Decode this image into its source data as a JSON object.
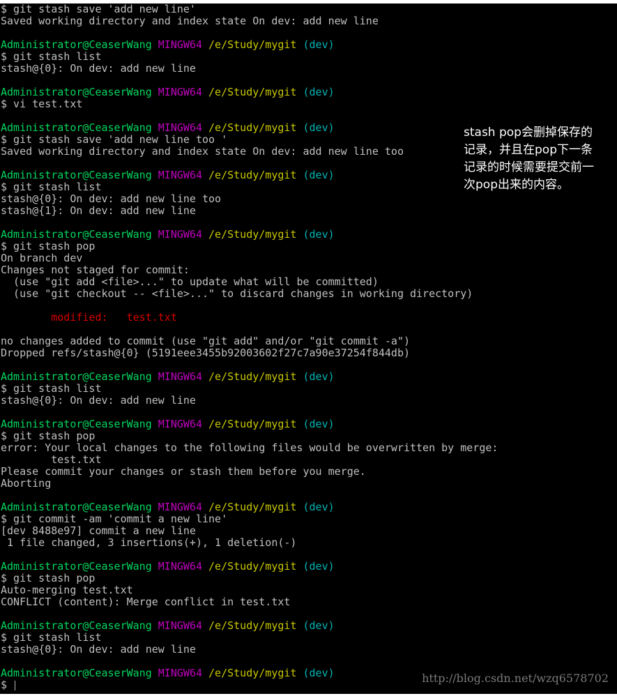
{
  "colors": {
    "background": "#000000",
    "text": "#c0c0c0",
    "user_host": "#00d75f",
    "mingw": "#c000c0",
    "path": "#c8c800",
    "branch": "#00b4b4",
    "modified": "#d70000",
    "annotation": "#ffffff",
    "watermark": "#7a7a7a"
  },
  "prompt": {
    "user_host": "Administrator@CeaserWang",
    "env": "MINGW64",
    "path": "/e/Study/mygit",
    "branch": "(dev)"
  },
  "lines": [
    "$ git stash save 'add new line'",
    "Saved working directory and index state On dev: add new line",
    "$ git stash list",
    "stash@{0}: On dev: add new line",
    "$ vi test.txt",
    "$ git stash save 'add new line too '",
    "Saved working directory and index state On dev: add new line too",
    "$ git stash list",
    "stash@{0}: On dev: add new line too",
    "stash@{1}: On dev: add new line",
    "$ git stash pop",
    "On branch dev",
    "Changes not staged for commit:",
    "  (use \"git add <file>...\" to update what will be committed)",
    "  (use \"git checkout -- <file>...\" to discard changes in working directory)",
    "        modified:   test.txt",
    "no changes added to commit (use \"git add\" and/or \"git commit -a\")",
    "Dropped refs/stash@{0} (5191eee3455b92003602f27c7a90e37254f844db)",
    "$ git stash list",
    "stash@{0}: On dev: add new line",
    "$ git stash pop",
    "error: Your local changes to the following files would be overwritten by merge:",
    "        test.txt",
    "Please commit your changes or stash them before you merge.",
    "Aborting",
    "$ git commit -am 'commit a new line'",
    "[dev 8488e97] commit a new line",
    " 1 file changed, 3 insertions(+), 1 deletion(-)",
    "$ git stash pop",
    "Auto-merging test.txt",
    "CONFLICT (content): Merge conflict in test.txt",
    "$ git stash list",
    "stash@{0}: On dev: add new line",
    "$ "
  ],
  "annotation": [
    "stash pop会删掉保存的",
    "记录，并且在pop下一条",
    "记录的时候需要提交前一",
    "次pop出来的内容。"
  ],
  "watermark": "http://blog.csdn.net/wzq6578702"
}
